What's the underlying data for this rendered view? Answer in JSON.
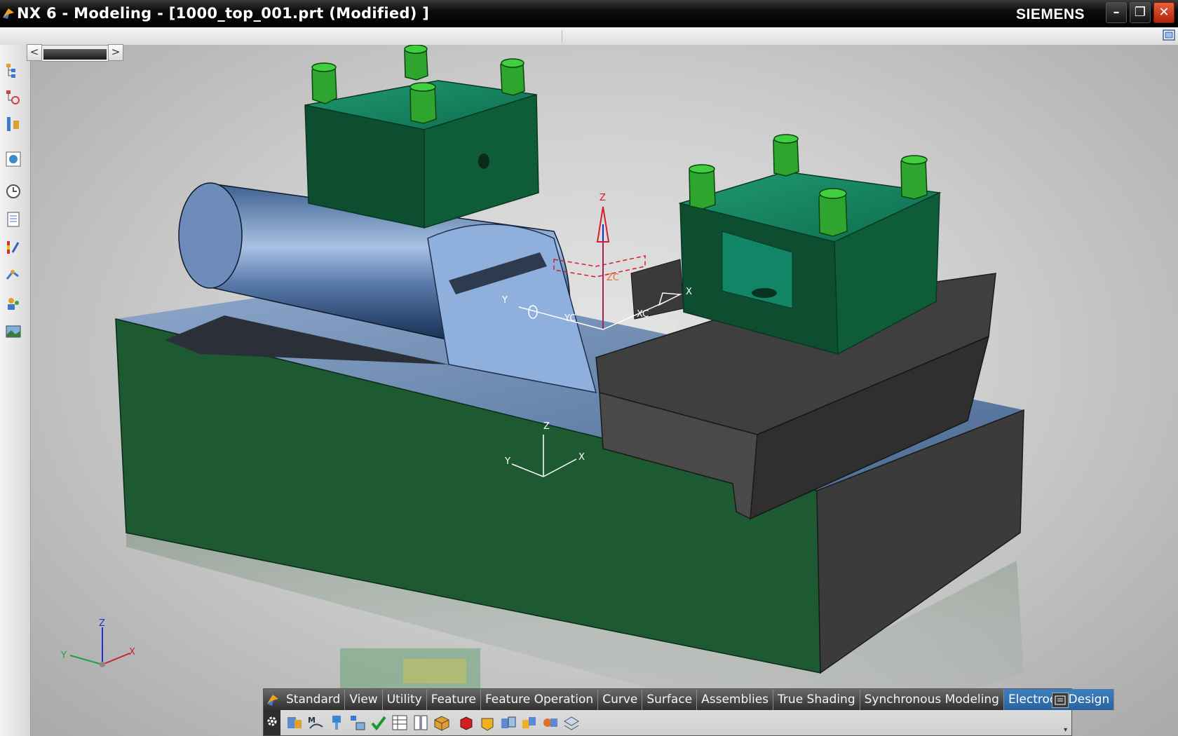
{
  "window": {
    "title": "NX 6 - Modeling - [1000_top_001.prt (Modified) ]",
    "brand": "SIEMENS",
    "minimize_label": "–",
    "restore_label": "❐",
    "close_label": "✕"
  },
  "navigator": {
    "prev_label": "<",
    "next_label": ">"
  },
  "resource_bar": {
    "icons": [
      "assembly-navigator-icon",
      "constraint-navigator-icon",
      "part-navigator-icon",
      "web-browser-icon",
      "history-icon",
      "reuse-library-icon",
      "hd3d-tools-icon",
      "process-studio-icon",
      "roles-icon",
      "system-scenes-icon"
    ]
  },
  "viewport": {
    "wcs_labels": {
      "z": "Z",
      "zc": "ZC",
      "yc": "YC",
      "xc": "XC",
      "x": "X",
      "y": "Y"
    },
    "absolute_csys_labels": {
      "z": "Z",
      "y": "Y",
      "x": "X"
    },
    "triad_labels": {
      "z": "Z",
      "y": "Y",
      "x": "X"
    },
    "colors": {
      "clamp_green": "#0f6b3c",
      "bolt_green": "#2ea52e",
      "base_green": "#1d5a31",
      "steel_blue": "#6f8fb8",
      "dark_steel": "#3e3e3e",
      "wcs_red": "#d0202a"
    }
  },
  "toolbar": {
    "tabs": [
      {
        "label": "Standard",
        "active": false
      },
      {
        "label": "View",
        "active": false
      },
      {
        "label": "Utility",
        "active": false
      },
      {
        "label": "Feature",
        "active": false
      },
      {
        "label": "Feature Operation",
        "active": false
      },
      {
        "label": "Curve",
        "active": false
      },
      {
        "label": "Surface",
        "active": false
      },
      {
        "label": "Assemblies",
        "active": false
      },
      {
        "label": "True Shading",
        "active": false
      },
      {
        "label": "Synchronous Modeling",
        "active": false
      },
      {
        "label": "Electrode Design",
        "active": true
      }
    ],
    "tools": [
      "electrode-wizard-icon",
      "design-electrode-icon",
      "electrode-hole-icon",
      "electrode-assembly-icon",
      "check-electrode-icon",
      "electrode-table-icon",
      "bill-of-material-icon",
      "electrode-package-icon",
      "electrode-block-icon",
      "electrode-head-icon",
      "electrode-clone-icon",
      "electrode-transform-icon",
      "electrode-trim-icon",
      "electrode-drawing-icon"
    ],
    "overflow_label": "▾"
  }
}
